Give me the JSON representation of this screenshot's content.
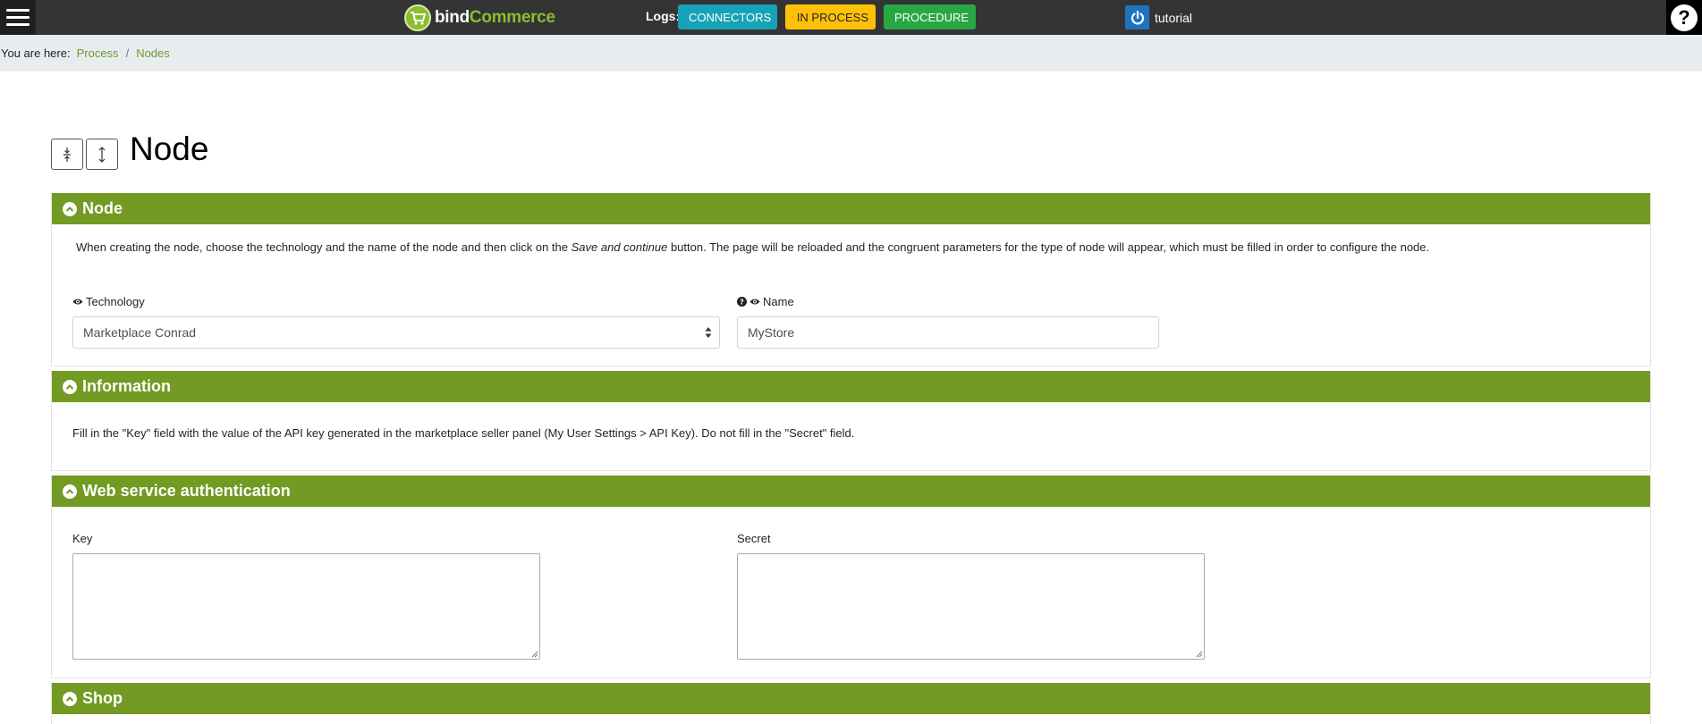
{
  "topbar": {
    "logo": {
      "part1": "bind",
      "part2": "Commerce"
    },
    "logs_label": "Logs:",
    "buttons": {
      "connectors": "CONNECTORS",
      "in_process": "IN PROCESS",
      "procedure": "PROCEDURE"
    },
    "username": "tutorial"
  },
  "breadcrumb": {
    "lead": "You are here:",
    "items": [
      "Process",
      "Nodes"
    ]
  },
  "title": "Node",
  "panels": {
    "node": {
      "header": "Node",
      "intro_before": "When creating the node, choose the technology and the name of the node and then click on the ",
      "intro_em": "Save and continue",
      "intro_after": " button. The page will be reloaded and the congruent parameters for the type of node will appear, which must be filled in order to configure the node.",
      "technology_label": "Technology",
      "technology_value": "Marketplace Conrad",
      "name_label": "Name",
      "name_value": "MyStore"
    },
    "information": {
      "header": "Information",
      "text": "Fill in the \"Key\" field with the value of the API key generated in the marketplace seller panel (My User Settings > API Key). Do not fill in the \"Secret\" field."
    },
    "auth": {
      "header": "Web service authentication",
      "key_label": "Key",
      "secret_label": "Secret"
    },
    "shop": {
      "header": "Shop"
    }
  },
  "colors": {
    "topbar": "#343434",
    "panel_header": "#739a22",
    "connectors": "#17a2b8",
    "in_process": "#ffc107",
    "procedure": "#28a745",
    "link": "#6a9a2f"
  }
}
